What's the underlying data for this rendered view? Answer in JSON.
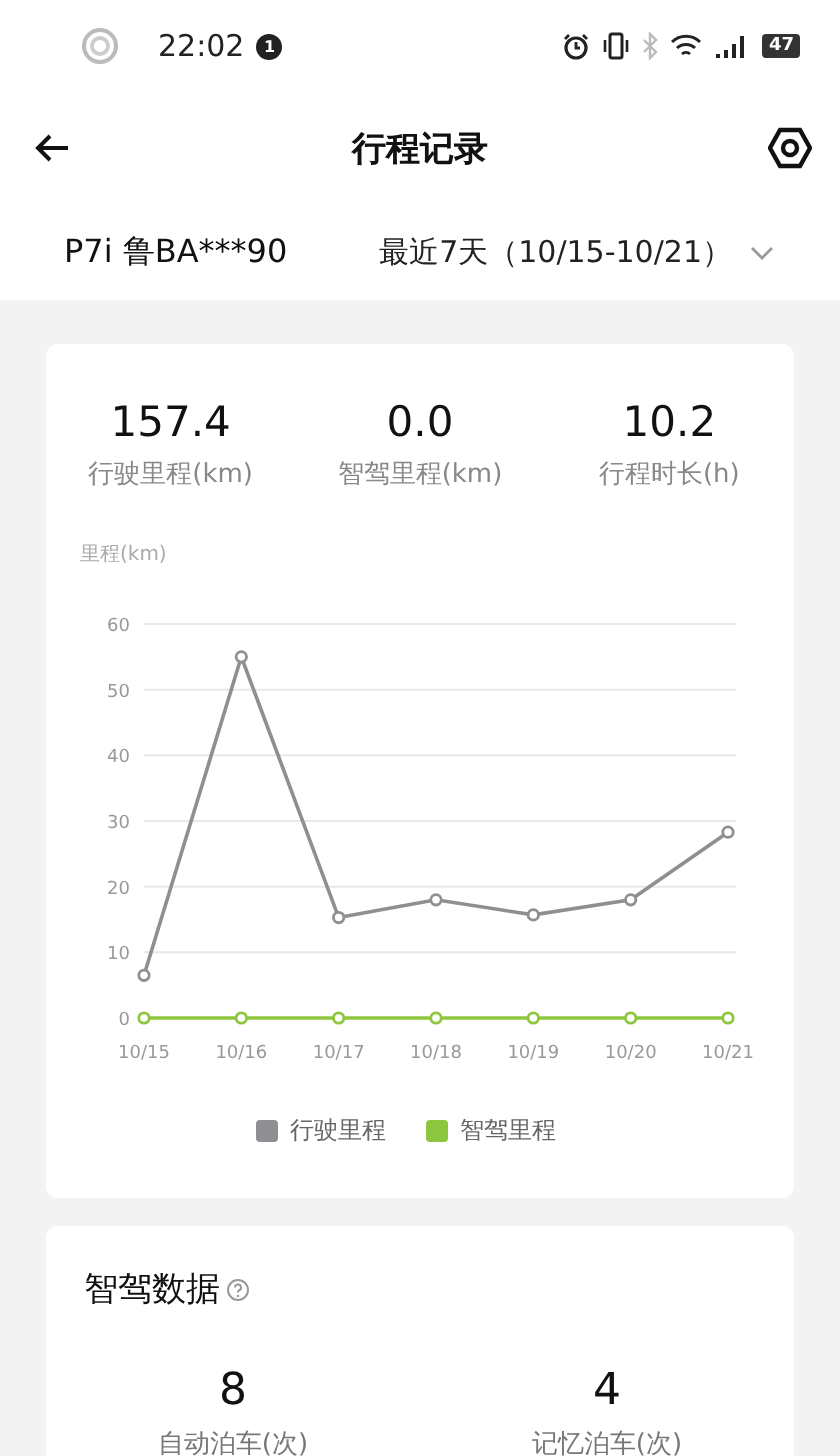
{
  "status_bar": {
    "time": "22:02",
    "notification_count": "1",
    "battery": "47"
  },
  "header": {
    "title": "行程记录"
  },
  "vehicle": {
    "name": "P7i 鲁BA***90",
    "range": "最近7天（10/15-10/21）"
  },
  "summary": [
    {
      "value": "157.4",
      "label": "行驶里程(km)"
    },
    {
      "value": "0.0",
      "label": "智驾里程(km)"
    },
    {
      "value": "10.2",
      "label": "行程时长(h)"
    }
  ],
  "chart_data": {
    "type": "line",
    "grid": true,
    "ylabel": "里程(km)",
    "categories": [
      "10/15",
      "10/16",
      "10/17",
      "10/18",
      "10/19",
      "10/20",
      "10/21"
    ],
    "ylim": [
      0,
      60
    ],
    "yticks": [
      0,
      10,
      20,
      30,
      40,
      50,
      60
    ],
    "series": [
      {
        "name": "行驶里程",
        "color": "#8e8e93",
        "marker": "circle",
        "values": [
          6.5,
          55,
          15.3,
          18,
          15.7,
          18,
          28.3
        ]
      },
      {
        "name": "智驾里程",
        "color": "#8dc63f",
        "marker": "circle",
        "values": [
          0,
          0,
          0,
          0,
          0,
          0,
          0
        ]
      }
    ]
  },
  "smart_driving": {
    "title": "智驾数据",
    "stats": [
      {
        "value": "8",
        "label": "自动泊车(次)"
      },
      {
        "value": "4",
        "label": "记忆泊车(次)"
      }
    ]
  }
}
